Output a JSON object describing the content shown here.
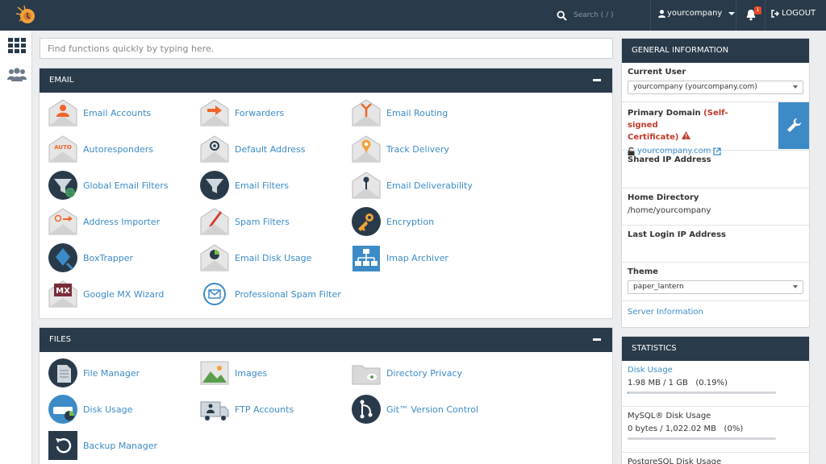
{
  "header": {
    "search_placeholder": "Search ( / )",
    "username": "yourcompany",
    "notification_count": "1",
    "logout_label": "LOGOUT"
  },
  "quick_search": {
    "placeholder": "Find functions quickly by typing here."
  },
  "email": {
    "title": "EMAIL",
    "items": [
      {
        "label": "Email Accounts",
        "icon": "email-accounts-icon"
      },
      {
        "label": "Forwarders",
        "icon": "forwarders-icon"
      },
      {
        "label": "Email Routing",
        "icon": "email-routing-icon"
      },
      {
        "label": "Autoresponders",
        "icon": "autoresponders-icon"
      },
      {
        "label": "Default Address",
        "icon": "default-address-icon"
      },
      {
        "label": "Track Delivery",
        "icon": "track-delivery-icon"
      },
      {
        "label": "Global Email Filters",
        "icon": "global-email-filters-icon"
      },
      {
        "label": "Email Filters",
        "icon": "email-filters-icon"
      },
      {
        "label": "Email Deliverability",
        "icon": "email-deliverability-icon"
      },
      {
        "label": "Address Importer",
        "icon": "address-importer-icon"
      },
      {
        "label": "Spam Filters",
        "icon": "spam-filters-icon"
      },
      {
        "label": "Encryption",
        "icon": "encryption-icon"
      },
      {
        "label": "BoxTrapper",
        "icon": "boxtrapper-icon"
      },
      {
        "label": "Email Disk Usage",
        "icon": "email-disk-usage-icon"
      },
      {
        "label": "Imap Archiver",
        "icon": "imap-archiver-icon"
      },
      {
        "label": "Google MX Wizard",
        "icon": "google-mx-wizard-icon"
      },
      {
        "label": "Professional Spam Filter",
        "icon": "professional-spam-filter-icon"
      }
    ],
    "auto_text": "AUTO",
    "mx_text": "MX"
  },
  "files": {
    "title": "FILES",
    "items": [
      {
        "label": "File Manager",
        "icon": "file-manager-icon"
      },
      {
        "label": "Images",
        "icon": "images-icon"
      },
      {
        "label": "Directory Privacy",
        "icon": "directory-privacy-icon"
      },
      {
        "label": "Disk Usage",
        "icon": "disk-usage-icon"
      },
      {
        "label": "FTP Accounts",
        "icon": "ftp-accounts-icon"
      },
      {
        "label": "Git™ Version Control",
        "icon": "git-version-control-icon"
      },
      {
        "label": "Backup Manager",
        "icon": "backup-manager-icon"
      }
    ]
  },
  "general_info": {
    "title": "GENERAL INFORMATION",
    "current_user_label": "Current User",
    "current_user_value": "yourcompany (yourcompany.com)",
    "primary_domain_label": "Primary Domain",
    "self_signed_line1": "(Self-signed",
    "self_signed_line2": "Certificate)",
    "domain_link": "yourcompany.com",
    "shared_ip_label": "Shared IP Address",
    "home_dir_label": "Home Directory",
    "home_dir_value": "/home/yourcompany",
    "last_login_label": "Last Login IP Address",
    "theme_label": "Theme",
    "theme_value": "paper_lantern",
    "server_info_link": "Server Information"
  },
  "statistics": {
    "title": "STATISTICS",
    "disk_usage_label": "Disk Usage",
    "disk_usage_value": "1.98 MB / 1 GB   (0.19%)",
    "disk_usage_fraction": 0.0019,
    "mysql_label": "MySQL® Disk Usage",
    "mysql_value": "0 bytes / 1,022.02 MB   (0%)",
    "mysql_fraction": 0,
    "postgres_label": "PostgreSQL Disk Usage"
  },
  "colors": {
    "header_bg": "#293a4a",
    "link_blue": "#3d8bc6",
    "accent_orange": "#f0642a",
    "warning_red": "#c0392b"
  }
}
